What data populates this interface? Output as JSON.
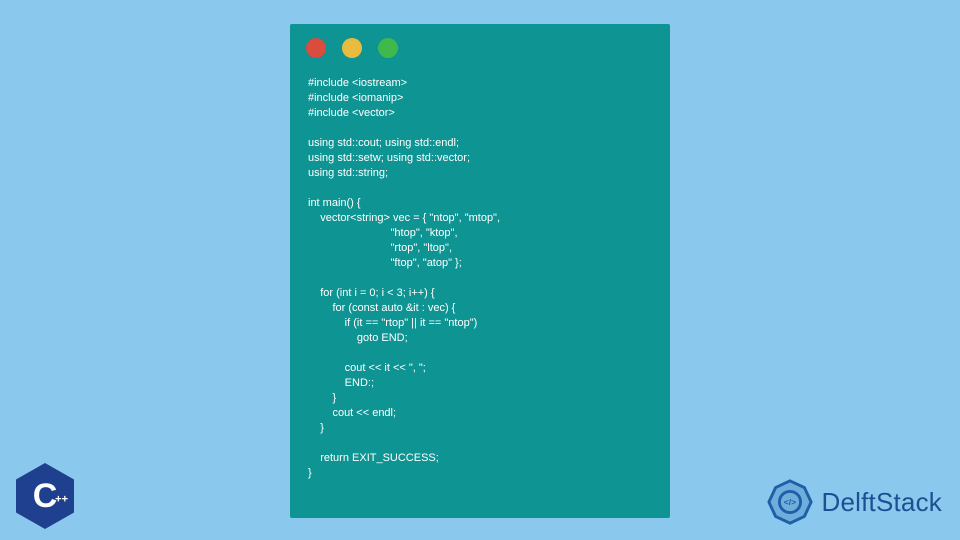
{
  "terminal": {
    "dots": [
      "red",
      "yellow",
      "green"
    ],
    "code": "#include <iostream>\n#include <iomanip>\n#include <vector>\n\nusing std::cout; using std::endl;\nusing std::setw; using std::vector;\nusing std::string;\n\nint main() {\n    vector<string> vec = { \"ntop\", \"mtop\",\n                           \"htop\", \"ktop\",\n                           \"rtop\", \"ltop\",\n                           \"ftop\", \"atop\" };\n\n    for (int i = 0; i < 3; i++) {\n        for (const auto &it : vec) {\n            if (it == \"rtop\" || it == \"ntop\")\n                goto END;\n\n            cout << it << \", \";\n            END:;\n        }\n        cout << endl;\n    }\n\n    return EXIT_SUCCESS;\n}"
  },
  "cpp_badge": {
    "letter": "C",
    "plus": "++"
  },
  "brand": {
    "name": "DelftStack"
  }
}
